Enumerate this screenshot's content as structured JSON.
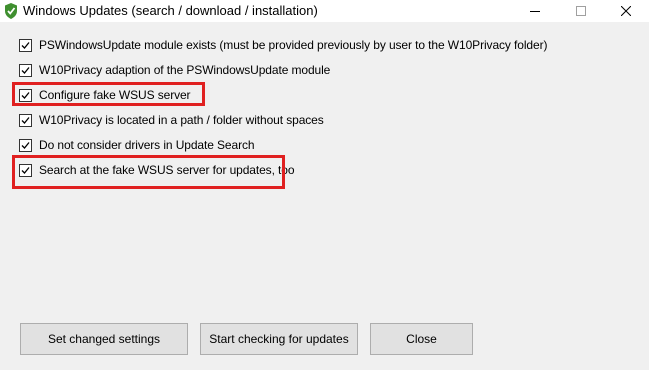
{
  "window": {
    "title": "Windows Updates (search / download / installation)",
    "icon": "shield-check-icon"
  },
  "options": [
    {
      "label": "PSWindowsUpdate module exists (must be provided previously by user to the W10Privacy folder)",
      "checked": true,
      "highlighted": false
    },
    {
      "label": "W10Privacy adaption of the PSWindowsUpdate module",
      "checked": true,
      "highlighted": false
    },
    {
      "label": "Configure fake WSUS server",
      "checked": true,
      "highlighted": true
    },
    {
      "label": "W10Privacy is located in a path / folder without spaces",
      "checked": true,
      "highlighted": false
    },
    {
      "label": "Do not consider drivers in Update Search",
      "checked": true,
      "highlighted": false
    },
    {
      "label": "Search at the fake WSUS server for updates, too",
      "checked": true,
      "highlighted": true
    }
  ],
  "buttons": {
    "set_changed": "Set changed settings",
    "start_checking": "Start checking for updates",
    "close": "Close"
  },
  "colors": {
    "highlight": "#e02020",
    "window_bg": "#f0f0f0",
    "button_bg": "#e1e1e1",
    "icon_green": "#3f8f2f"
  }
}
